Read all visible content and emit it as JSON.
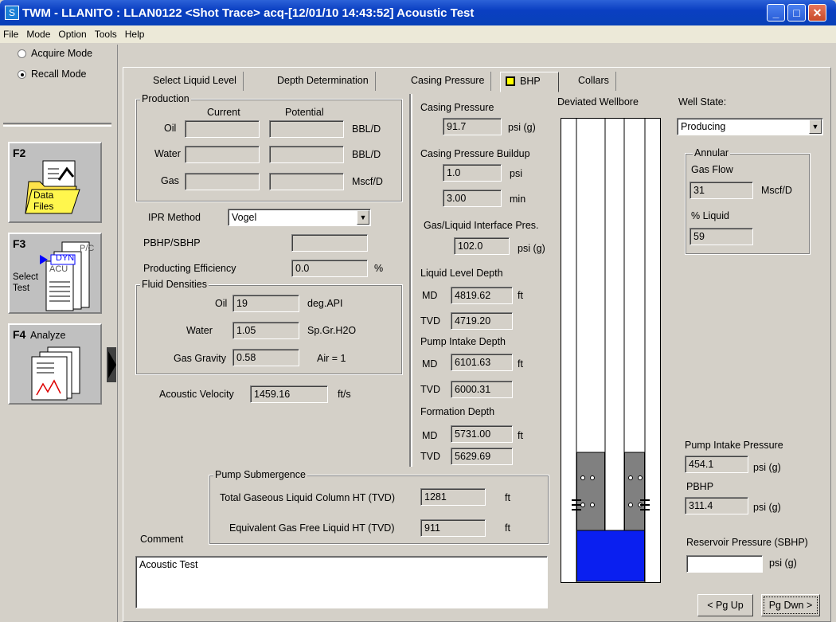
{
  "window": {
    "title": "TWM  - LLANITO : LLAN0122  <Shot Trace>  acq-[12/01/10 14:43:52]  Acoustic Test",
    "icon_glyph": "S"
  },
  "menu": [
    "File",
    "Mode",
    "Option",
    "Tools",
    "Help"
  ],
  "left": {
    "acquire_label": "Acquire Mode",
    "recall_label": "Recall Mode",
    "f2_key": "F2",
    "f2_label_line1": "Data",
    "f2_label_line2": "Files",
    "f3_key": "F3",
    "f3_label_line1": "Select",
    "f3_label_line2": "Test",
    "f3_pc": "P/C",
    "f3_dyn": "DYN",
    "f3_acu": "ACU",
    "f4_key": "F4",
    "f4_label": "Analyze"
  },
  "tabs": [
    "Select Liquid Level",
    "Depth Determination",
    "Casing Pressure",
    "BHP",
    "Collars"
  ],
  "production": {
    "title": "Production",
    "current": "Current",
    "potential": "Potential",
    "rows": [
      {
        "label": "Oil",
        "unit": "BBL/D"
      },
      {
        "label": "Water",
        "unit": "BBL/D"
      },
      {
        "label": "Gas",
        "unit": "Mscf/D"
      }
    ]
  },
  "ipr": {
    "label": "IPR Method",
    "value": "Vogel"
  },
  "pbhp_sbhp_label": "PBHP/SBHP",
  "efficiency": {
    "label": "Producting Efficiency",
    "value": "0.0",
    "unit": "%"
  },
  "fluid": {
    "title": "Fluid Densities",
    "oil": {
      "label": "Oil",
      "value": "19",
      "unit": "deg.API"
    },
    "water": {
      "label": "Water",
      "value": "1.05",
      "unit": "Sp.Gr.H2O"
    },
    "gas": {
      "label": "Gas Gravity",
      "value": "0.58",
      "unit": "Air = 1"
    }
  },
  "acoustic": {
    "label": "Acoustic Velocity",
    "value": "1459.16",
    "unit": "ft/s"
  },
  "casing": {
    "title": "Casing Pressure",
    "value": "91.7",
    "unit": "psi (g)",
    "buildup_title": "Casing Pressure Buildup",
    "buildup_value": "1.0",
    "buildup_unit": "psi",
    "min_value": "3.00",
    "min_unit": "min",
    "interface_title": "Gas/Liquid Interface Pres.",
    "interface_value": "102.0",
    "interface_unit": "psi (g)"
  },
  "liquid_level": {
    "title": "Liquid Level Depth",
    "md_label": "MD",
    "md": "4819.62",
    "unit": "ft",
    "tvd_label": "TVD",
    "tvd": "4719.20"
  },
  "pump_intake_depth": {
    "title": "Pump Intake Depth",
    "md_label": "MD",
    "md": "6101.63",
    "unit": "ft",
    "tvd_label": "TVD",
    "tvd": "6000.31"
  },
  "formation_depth": {
    "title": "Formation Depth",
    "md_label": "MD",
    "md": "5731.00",
    "unit": "ft",
    "tvd_label": "TVD",
    "tvd": "5629.69"
  },
  "wellbore": {
    "title": "Deviated Wellbore"
  },
  "well_state": {
    "label": "Well State:",
    "value": "Producing"
  },
  "annular": {
    "title": "Annular",
    "gas_flow_label": "Gas Flow",
    "gas_flow": "31",
    "gas_flow_unit": "Mscf/D",
    "liquid_label": "% Liquid",
    "liquid": "59"
  },
  "pump_intake_pressure": {
    "label": "Pump Intake Pressure",
    "value": "454.1",
    "unit": "psi (g)"
  },
  "pbhp": {
    "label": "PBHP",
    "value": "311.4",
    "unit": "psi (g)"
  },
  "reservoir": {
    "label": "Reservoir Pressure (SBHP)",
    "unit": "psi (g)"
  },
  "submergence": {
    "title": "Pump Submergence",
    "total_label": "Total Gaseous Liquid Column HT  (TVD)",
    "total_value": "1281",
    "total_unit": "ft",
    "equiv_label": "Equivalent Gas Free Liquid HT  (TVD)",
    "equiv_value": "911",
    "equiv_unit": "ft"
  },
  "comment": {
    "label": "Comment",
    "value": "Acoustic Test"
  },
  "nav": {
    "pgup": "< Pg Up",
    "pgdn": "Pg Dwn >"
  },
  "colors": {
    "titlebar": "#0a3fc2",
    "fluid_blue": "#0a1ff0",
    "packer_gray": "#808080",
    "yellow_tab": "#ffff00"
  }
}
